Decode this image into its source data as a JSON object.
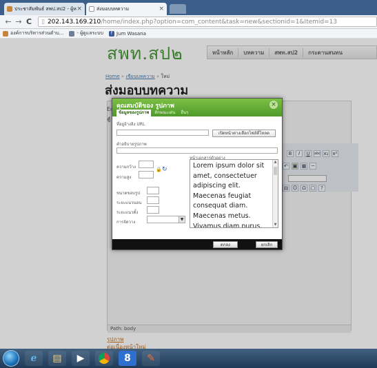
{
  "browser": {
    "tabs": [
      {
        "label": "ประชาสัมพันธ์ สพป.สป2 - ผู้ห"
      },
      {
        "label": "ส่งมอบบทความ"
      }
    ],
    "url_host": "202.143.169.210",
    "url_path": "/home/index.php?option=com_content&task=new&sectionid=1&Itemid=13",
    "bookmarks": [
      "องค์การบริหารส่วนตำบ...",
      "- ผู้ดูแลระบบ",
      "Jum Wasana"
    ]
  },
  "site": {
    "logo": "สพท.สป๒",
    "nav": [
      "หน้าหลัก",
      "บทความ",
      "สพท.สป2",
      "กระดานสนทน"
    ]
  },
  "breadcrumb": {
    "home": "Home",
    "sep": "»",
    "section": "เขียนบทความ",
    "current": "ใหม่"
  },
  "page_title": "ส่งมอบบทความ",
  "editor": {
    "path_label": "Path: body",
    "left_fragments": [
      "Ed",
      "ชื่"
    ],
    "toolbar_buttons": [
      "B",
      "I",
      "U",
      "abc",
      "x₂",
      "x²"
    ],
    "below_links": [
      "รูปภาพ",
      "ต่อเนื่องหน้าใหม่"
    ]
  },
  "dialog": {
    "title": "คุณสมบัติของ รูปภาพ",
    "close_symbol": "×",
    "tabs": [
      "ข้อมูลของรูปภาพ",
      "ลักษณะเด่น",
      "อื่นๆ"
    ],
    "url_label": "ที่อยู่อ้างอิง URL",
    "browse_button": "เปิดหน้าต่างเลือกไฟล์ที่โหลด",
    "alt_label": "คำอธิบายรูปภาพ",
    "width_label": "ความกว้าง",
    "height_label": "ความสูง",
    "border_label": "ขนาดขอบรูป",
    "hspace_label": "ระยะแนวนอน",
    "vspace_label": "ระยะแนวตั้ง",
    "align_label": "การจัดวาง",
    "preview_label": "หน้าเอกสารตัวอย่าง",
    "preview_text": "Lorem ipsum dolor sit amet, consectetuer adipiscing elit. Maecenas feugiat consequat diam. Maecenas metus. Vivamus diam purus, cursus a, commodo non, facilisis",
    "ok_button": "ตกลง",
    "cancel_button": "ยกเลิก"
  },
  "colors": {
    "brand_green": "#4a9a3a",
    "dialog_header": "#5aa532",
    "link_orange": "#c7701a"
  }
}
